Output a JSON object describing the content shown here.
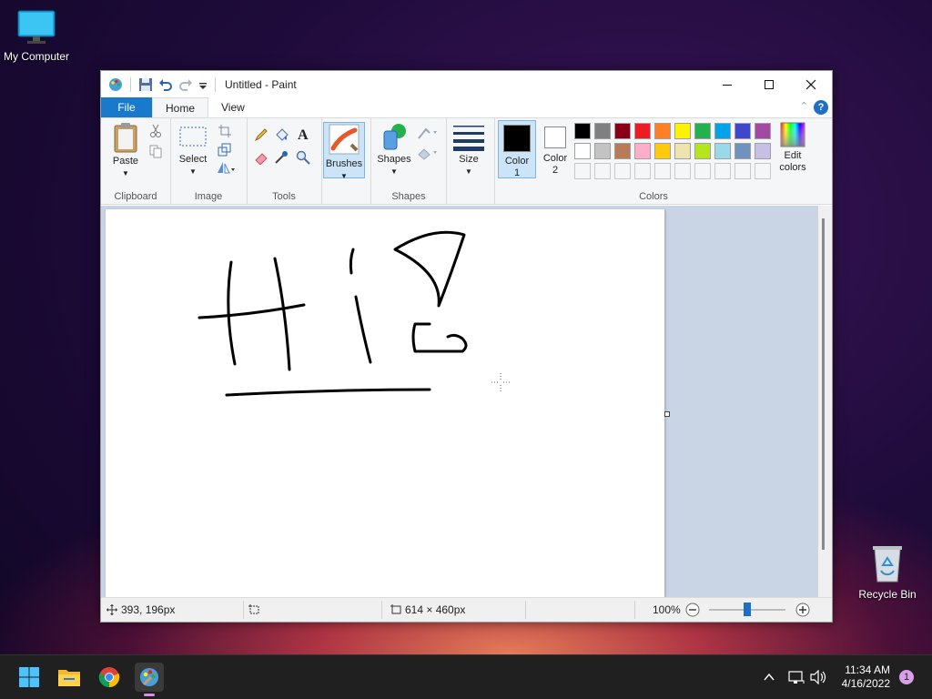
{
  "desktop": {
    "my_computer": "My Computer",
    "recycle_bin": "Recycle Bin"
  },
  "window": {
    "title": "Untitled - Paint"
  },
  "tabs": {
    "file": "File",
    "home": "Home",
    "view": "View"
  },
  "ribbon": {
    "clipboard": {
      "paste": "Paste",
      "group": "Clipboard"
    },
    "image": {
      "select": "Select",
      "group": "Image"
    },
    "tools": {
      "group": "Tools"
    },
    "brushes": "Brushes",
    "shapes": {
      "shapes": "Shapes",
      "group": "Shapes"
    },
    "size": "Size",
    "color1_line1": "Color",
    "color1_line2": "1",
    "color2_line1": "Color",
    "color2_line2": "2",
    "edit_colors_line1": "Edit",
    "edit_colors_line2": "colors",
    "colors_group": "Colors"
  },
  "palette": {
    "row1": [
      "#000000",
      "#7f7f7f",
      "#880015",
      "#ed1c24",
      "#ff7f27",
      "#fff200",
      "#22b14c",
      "#00a2e8",
      "#3f48cc",
      "#a349a4"
    ],
    "row2": [
      "#ffffff",
      "#c3c3c3",
      "#b97a57",
      "#ffaec9",
      "#ffc90e",
      "#efe4b0",
      "#b5e61d",
      "#99d9ea",
      "#7092be",
      "#c8bfe7"
    ],
    "color1": "#000000",
    "color2": "#ffffff"
  },
  "status": {
    "cursor_pos": "393, 196px",
    "canvas_size": "614 × 460px",
    "zoom": "100%"
  },
  "taskbar": {
    "time": "11:34 AM",
    "date": "4/16/2022",
    "notification_count": "1"
  }
}
